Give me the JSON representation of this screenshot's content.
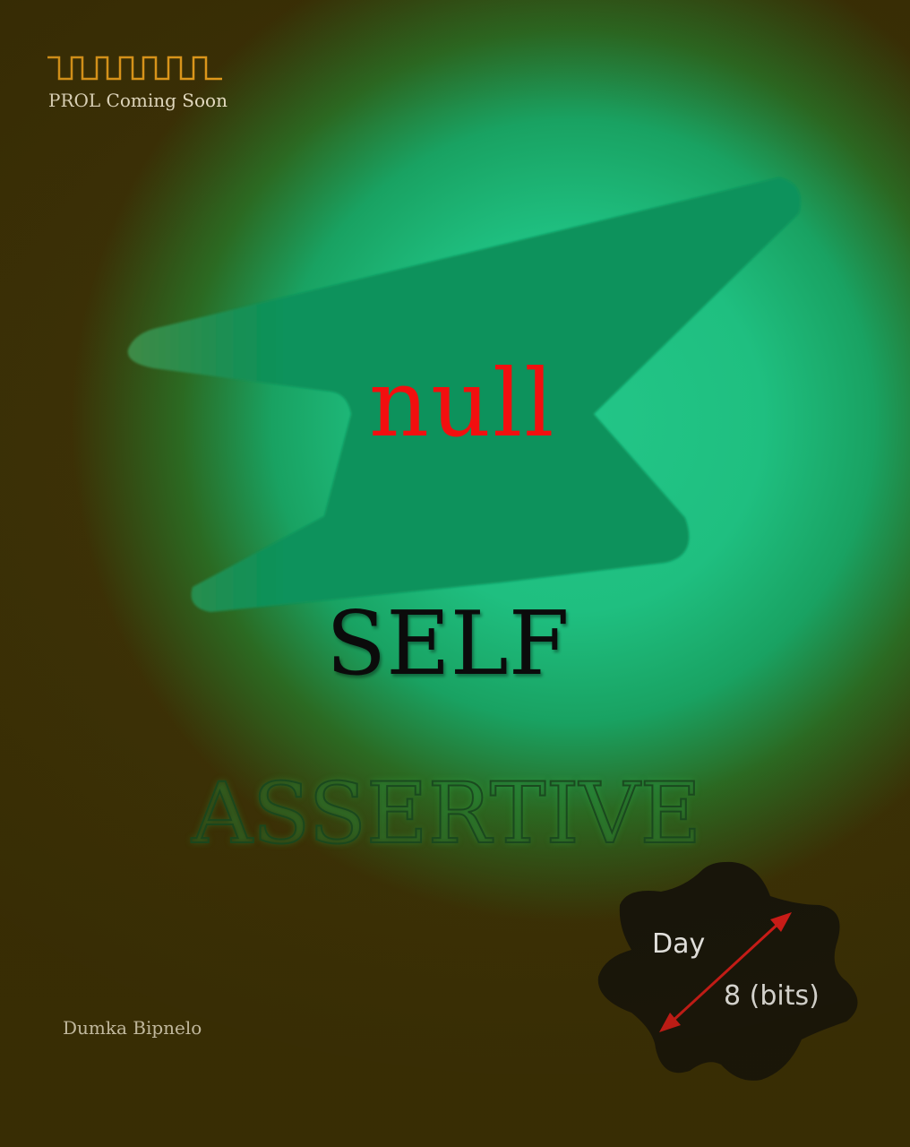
{
  "header": {
    "brand_text": "PROL Coming Soon",
    "logo_icon": "square-wave-icon"
  },
  "headline": {
    "word_1": "null",
    "word_2": "SELF",
    "word_3": "ASSERTIVE"
  },
  "footer": {
    "author": "Dumka Bipnelo"
  },
  "badge": {
    "day_label": "Day",
    "count_label": "8 (bits)",
    "arrow_icon": "double-arrow-icon"
  },
  "colors": {
    "background_dark": "#3b3006",
    "glow_green": "#23c688",
    "shape_green": "#06915a",
    "accent_red": "#f20f0f",
    "wave_orange": "#f0a41e",
    "badge_black": "#16140b"
  }
}
